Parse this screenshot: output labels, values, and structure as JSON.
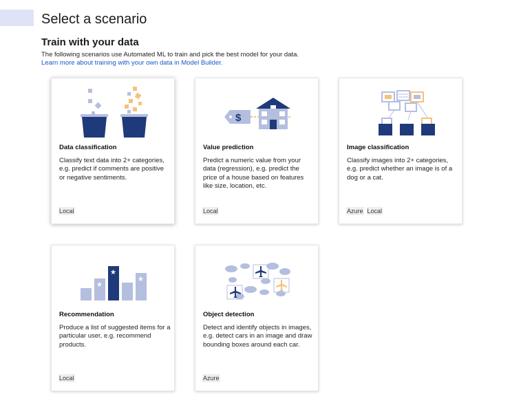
{
  "page": {
    "title": "Select a scenario"
  },
  "section": {
    "title": "Train with your data",
    "description": "The following scenarios use Automated ML to train and pick the best model for your data.",
    "learn_more": "Learn more about training with your own data in Model Builder."
  },
  "colors": {
    "navy": "#1f3a7a",
    "light_blue": "#b4bedf",
    "pale_blue": "#dfe3f7",
    "orange": "#f5c27a",
    "link": "#1a56c8"
  },
  "cards": [
    {
      "title": "Data classification",
      "description": "Classify text data into 2+ categories, e.g. predict if comments are positive or negative sentiments.",
      "tags": [
        "Local"
      ],
      "icon": "buckets-icon"
    },
    {
      "title": "Value prediction",
      "description": "Predict a numeric value from your data (regression), e.g. predict the price of a house based on features like size, location, etc.",
      "tags": [
        "Local"
      ],
      "icon": "house-price-icon"
    },
    {
      "title": "Image classification",
      "description": "Classify images into 2+ categories, e.g. predict whether an image is of a dog or a cat.",
      "tags": [
        "Azure",
        "Local"
      ],
      "icon": "image-folders-icon"
    },
    {
      "title": "Recommendation",
      "description": "Produce a list of suggested items for a particular user, e.g. recommend products.",
      "tags": [
        "Local"
      ],
      "icon": "star-bars-icon"
    },
    {
      "title": "Object detection",
      "description": "Detect and identify objects in images, e.g. detect cars in an image and draw bounding boxes around each car.",
      "tags": [
        "Azure"
      ],
      "icon": "planes-clouds-icon"
    }
  ]
}
